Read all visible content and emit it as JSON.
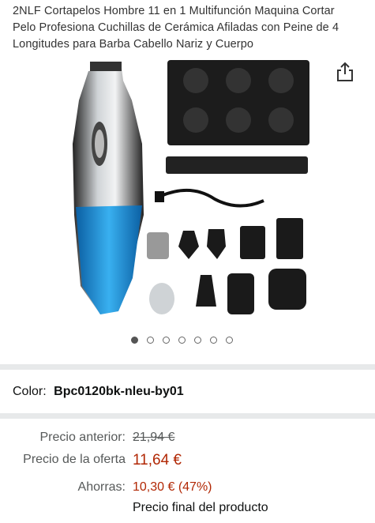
{
  "product": {
    "title": "2NLF Cortapelos Hombre 11 en 1 Multifunción Maquina Cortar Pelo Profesiona Cuchillas de Cerámica Afiladas con Peine de 4 Longitudes para Barba Cabello Nariz y Cuerpo"
  },
  "gallery": {
    "image_count": 7,
    "active_index": 0
  },
  "variation": {
    "label": "Color:",
    "value": "Bpc0120bk-nleu-by01"
  },
  "pricing": {
    "previous_label": "Precio anterior:",
    "previous_value": "21,94 €",
    "deal_label": "Precio de la oferta",
    "deal_value": "11,64 €",
    "savings_label": "Ahorras:",
    "savings_value": "10,30 € (47%)",
    "final_note": "Precio final del producto"
  },
  "colors": {
    "deal_red": "#b12704",
    "divider_gray": "#e7e9ea",
    "clipper_blue": "#1e8fd6"
  },
  "icons": {
    "share": "share-icon"
  }
}
